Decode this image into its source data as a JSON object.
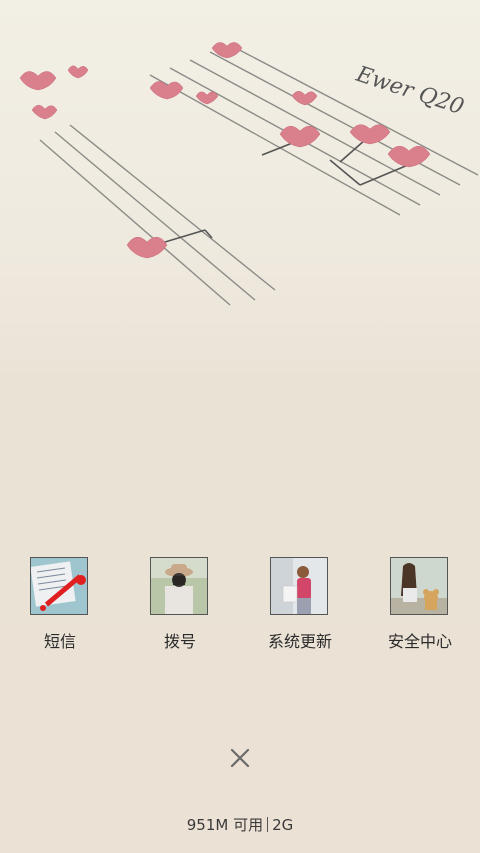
{
  "wallpaper": {
    "handwriting": "Ewer Q20"
  },
  "recent_apps": [
    {
      "label": "短信",
      "icon": "sms-thumbnail"
    },
    {
      "label": "拨号",
      "icon": "dialer-thumbnail"
    },
    {
      "label": "系统更新",
      "icon": "system-update-thumbnail"
    },
    {
      "label": "安全中心",
      "icon": "security-center-thumbnail"
    }
  ],
  "close_button": {
    "icon": "close-icon"
  },
  "memory": {
    "available": "951M 可用",
    "total": "2G"
  },
  "colors": {
    "background": "#ece3d8",
    "heart": "#d9808c"
  }
}
